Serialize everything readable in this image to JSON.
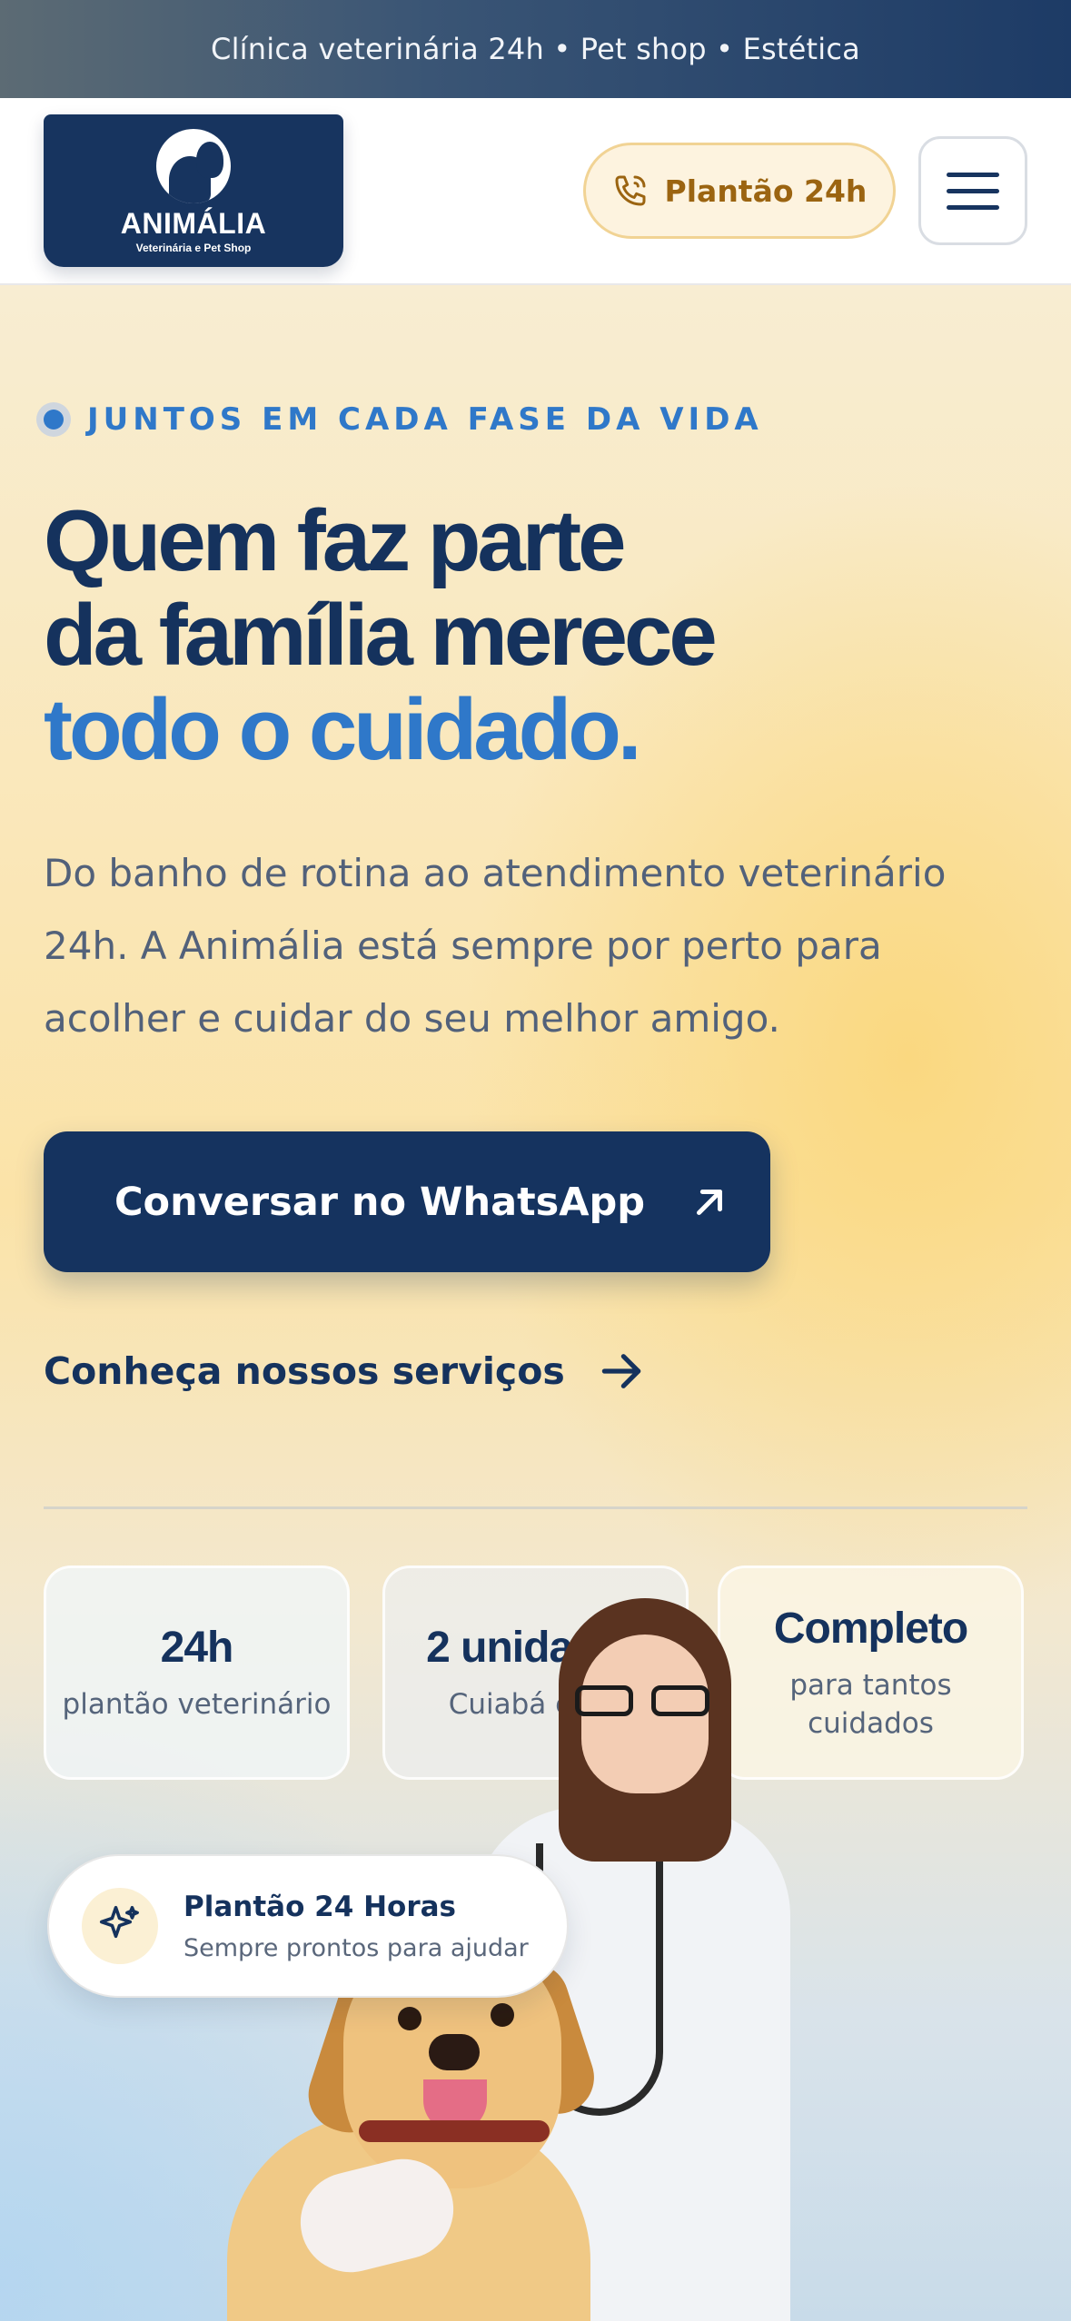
{
  "topbar": {
    "text": "Clínica veterinária 24h • Pet shop • Estética"
  },
  "header": {
    "logo": {
      "name": "ANIMÁLIA",
      "subtitle": "Veterinária e Pet Shop"
    },
    "plantao_button": "Plantão 24h",
    "menu_icon": "hamburger-menu-icon"
  },
  "hero": {
    "eyebrow": "JUNTOS EM CADA FASE DA VIDA",
    "headline": {
      "line1": "Quem faz parte",
      "line2": "da família merece",
      "accent": "todo o cuidado",
      "period": "."
    },
    "lead": "Do banho de rotina ao atendimento veterinário 24h. A Animália está sempre por perto para acolher e cuidar do seu melhor amigo.",
    "cta_primary": "Conversar no WhatsApp",
    "cta_secondary": "Conheça nossos serviços"
  },
  "stats": [
    {
      "value": "24h",
      "label": "plantão veterinário"
    },
    {
      "value": "2 unidades",
      "label": "Cuiabá e VG"
    },
    {
      "value": "Completo",
      "label": "para tantos cuidados"
    }
  ],
  "badge": {
    "icon": "sparkle-icon",
    "title": "Plantão 24 Horas",
    "subtitle": "Sempre prontos para ajudar"
  },
  "colors": {
    "navy": "#15325d",
    "accent_blue": "#2f78c9",
    "amber": "#9b6411",
    "amber_bg": "#fdf3df"
  }
}
